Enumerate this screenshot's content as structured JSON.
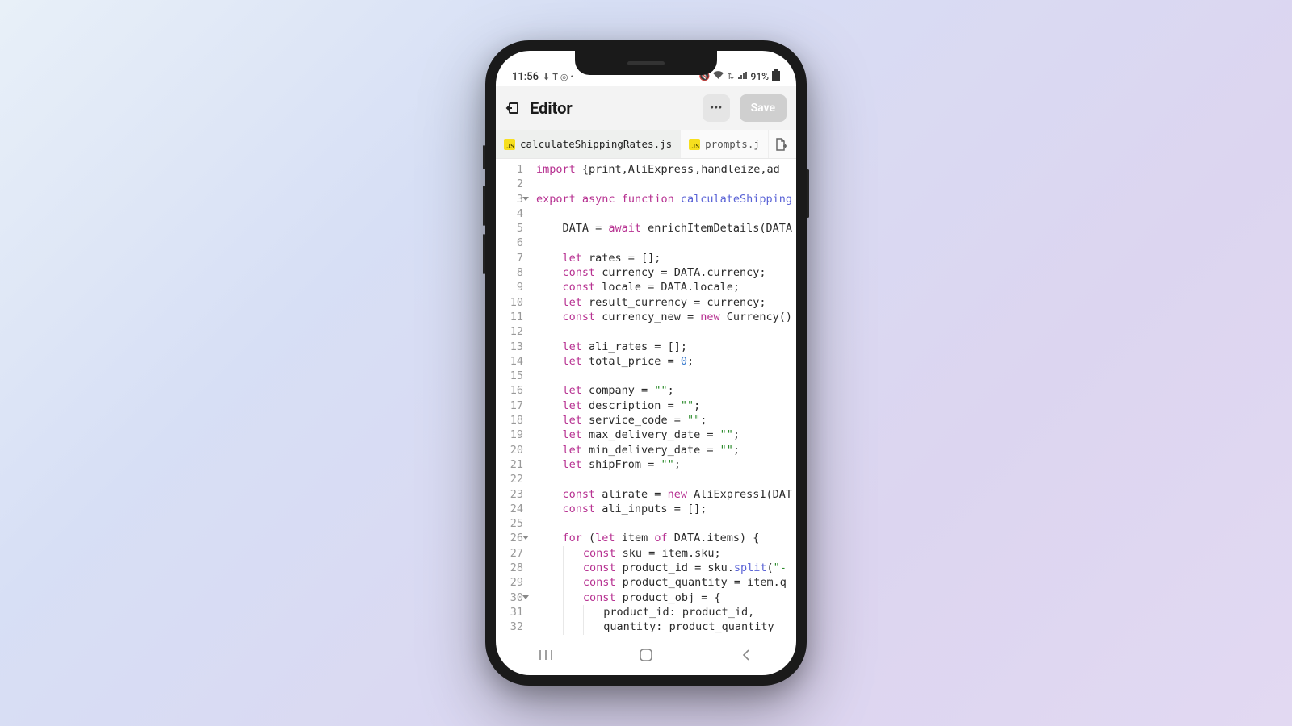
{
  "status": {
    "time": "11:56",
    "battery_text": "91%"
  },
  "header": {
    "title": "Editor",
    "save_label": "Save"
  },
  "tabs": {
    "active": "calculateShippingRates.js",
    "second": "prompts.j"
  },
  "code_lines": [
    {
      "n": 1,
      "fold": false
    },
    {
      "n": 2,
      "fold": false
    },
    {
      "n": 3,
      "fold": true
    },
    {
      "n": 4,
      "fold": false
    },
    {
      "n": 5,
      "fold": false
    },
    {
      "n": 6,
      "fold": false
    },
    {
      "n": 7,
      "fold": false
    },
    {
      "n": 8,
      "fold": false
    },
    {
      "n": 9,
      "fold": false
    },
    {
      "n": 10,
      "fold": false
    },
    {
      "n": 11,
      "fold": false
    },
    {
      "n": 12,
      "fold": false
    },
    {
      "n": 13,
      "fold": false
    },
    {
      "n": 14,
      "fold": false
    },
    {
      "n": 15,
      "fold": false
    },
    {
      "n": 16,
      "fold": false
    },
    {
      "n": 17,
      "fold": false
    },
    {
      "n": 18,
      "fold": false
    },
    {
      "n": 19,
      "fold": false
    },
    {
      "n": 20,
      "fold": false
    },
    {
      "n": 21,
      "fold": false
    },
    {
      "n": 22,
      "fold": false
    },
    {
      "n": 23,
      "fold": false
    },
    {
      "n": 24,
      "fold": false
    },
    {
      "n": 25,
      "fold": false
    },
    {
      "n": 26,
      "fold": true
    },
    {
      "n": 27,
      "fold": false
    },
    {
      "n": 28,
      "fold": false
    },
    {
      "n": 29,
      "fold": false
    },
    {
      "n": 30,
      "fold": true
    },
    {
      "n": 31,
      "fold": false
    },
    {
      "n": 32,
      "fold": false
    }
  ],
  "source": {
    "l1": "import {print,AliExpress|,handleize,ad",
    "l3": "export async function calculateShipping",
    "l5": "    DATA = await enrichItemDetails(DATA",
    "l7": "    let rates = [];",
    "l8": "    const currency = DATA.currency;",
    "l9": "    const locale = DATA.locale;",
    "l10": "    let result_currency = currency;",
    "l11": "    const currency_new = new Currency()",
    "l13": "    let ali_rates = [];",
    "l14": "    let total_price = 0;",
    "l16": "    let company = \"\";",
    "l17": "    let description = \"\";",
    "l18": "    let service_code = \"\";",
    "l19": "    let max_delivery_date = \"\";",
    "l20": "    let min_delivery_date = \"\";",
    "l21": "    let shipFrom = \"\";",
    "l23": "    const alirate = new AliExpress1(DAT",
    "l24": "    const ali_inputs = [];",
    "l26": "    for (let item of DATA.items) {",
    "l27": "        const sku = item.sku;",
    "l28": "        const product_id = sku.split(\"-",
    "l29": "        const product_quantity = item.q",
    "l30": "        const product_obj = {",
    "l31": "            product_id: product_id,",
    "l32": "            quantity: product_quantity"
  }
}
